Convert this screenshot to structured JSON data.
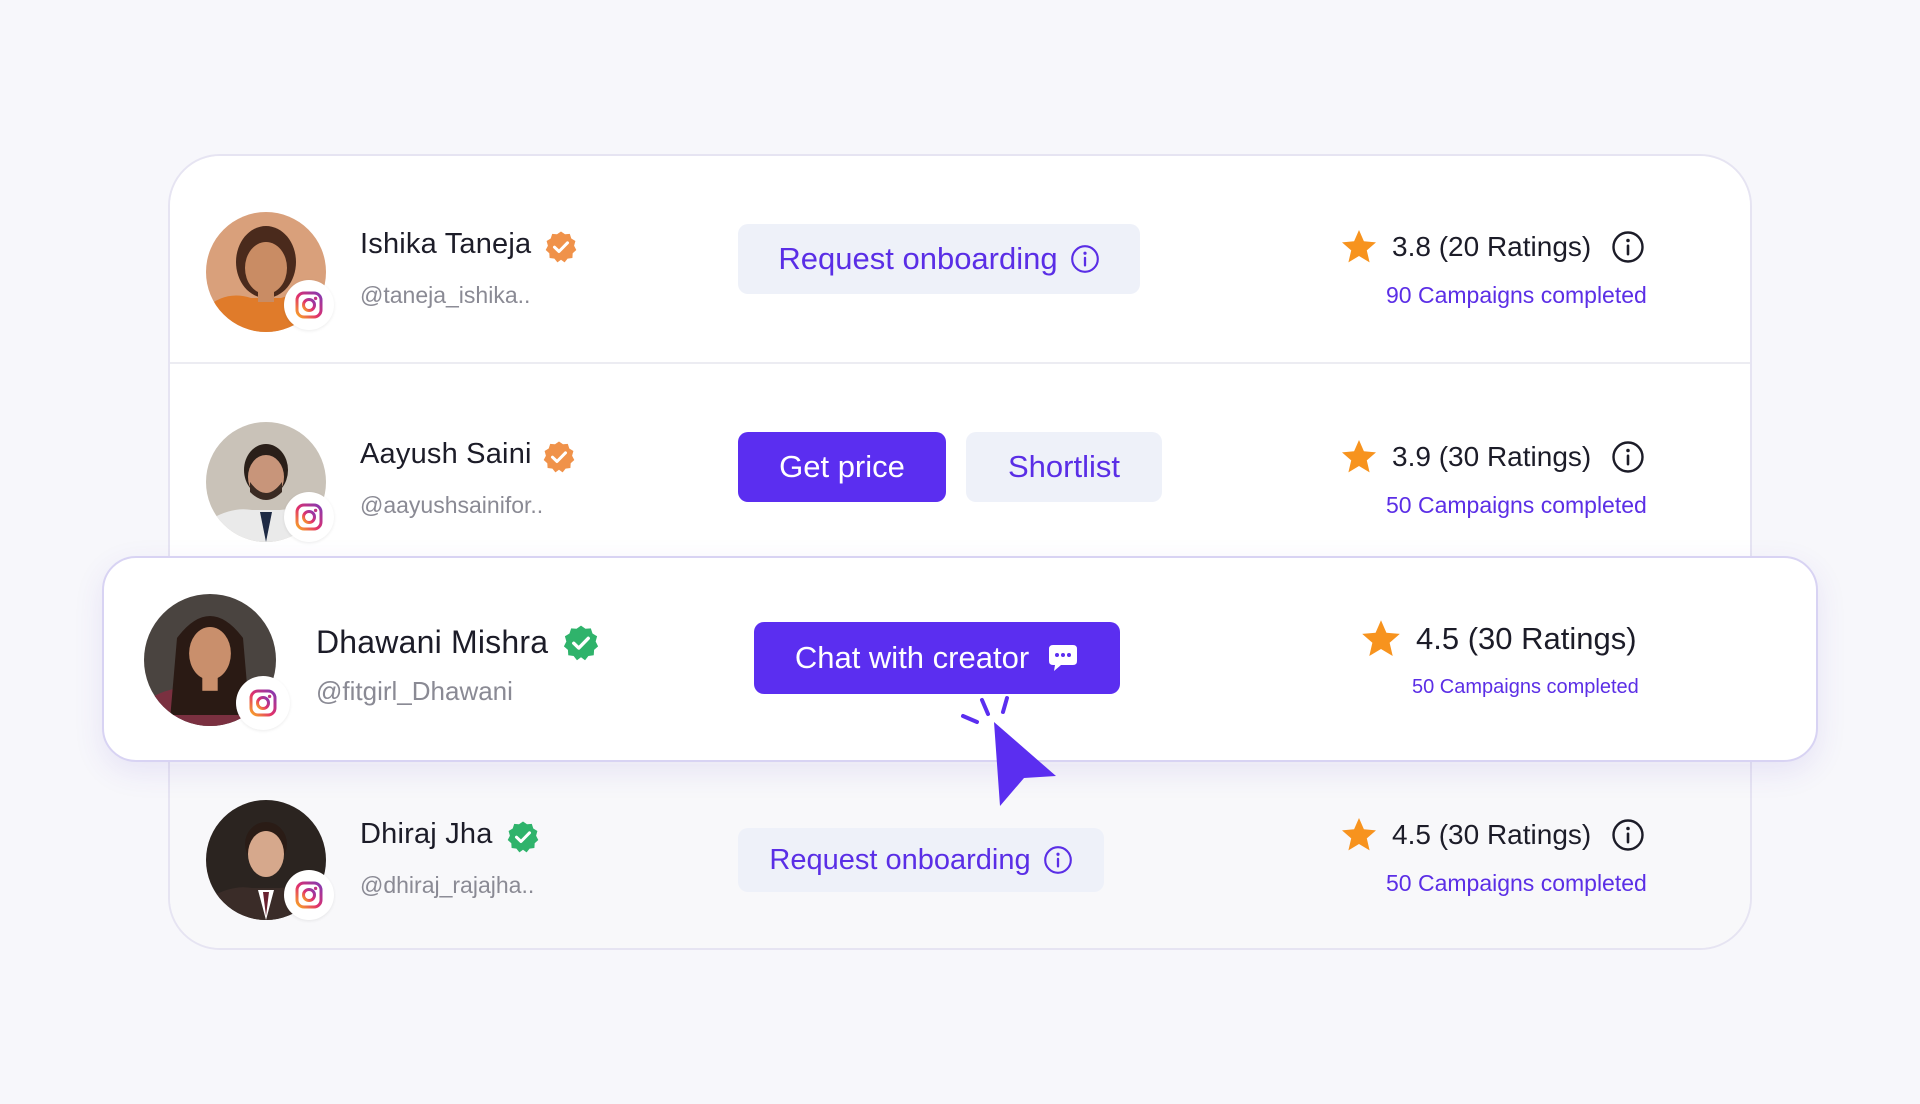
{
  "creators": [
    {
      "name": "Ishika Taneja",
      "handle": "@taneja_ishika..",
      "verified_color": "#f0924a",
      "actions": [
        "Request onboarding"
      ],
      "rating": "3.8 (20 Ratings)",
      "campaigns": "90 Campaigns completed"
    },
    {
      "name": "Aayush Saini",
      "handle": "@aayushsainifor..",
      "verified_color": "#f0924a",
      "actions": [
        "Get price",
        "Shortlist"
      ],
      "rating": "3.9 (30 Ratings)",
      "campaigns": "50 Campaigns completed"
    },
    {
      "name": "Dhawani Mishra",
      "handle": "@fitgirl_Dhawani",
      "verified_color": "#2fb36b",
      "actions": [
        "Chat with creator"
      ],
      "rating": "4.5 (30 Ratings)",
      "campaigns": "50 Campaigns completed"
    },
    {
      "name": "Dhiraj Jha",
      "handle": "@dhiraj_rajajha..",
      "verified_color": "#2fb36b",
      "actions": [
        "Request onboarding"
      ],
      "rating": "4.5 (30 Ratings)",
      "campaigns": "50 Campaigns completed"
    }
  ],
  "icons": {
    "social": "instagram-icon",
    "verified": "verified-badge-icon",
    "rating": "star-icon",
    "info": "info-icon",
    "chat": "chat-bubble-icon",
    "pointer": "cursor-pointer-icon"
  },
  "colors": {
    "primary": "#5b2ef0",
    "light_button": "#eef1f9",
    "star": "#f7931e",
    "link": "#5b2ee6"
  }
}
